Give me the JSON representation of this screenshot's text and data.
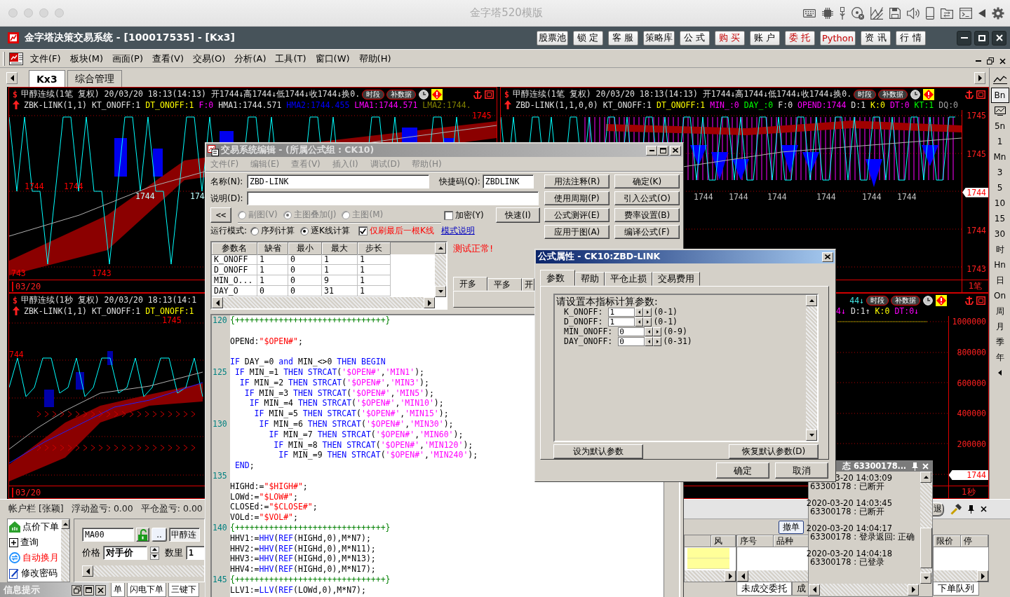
{
  "mac_window": {
    "title": "金字塔520模版"
  },
  "app_window": {
    "title": "金字塔决策交易系统 - [100017535] - [Kx3]",
    "toolbar": [
      {
        "label": "股票池",
        "kind": "plain"
      },
      {
        "label": "锁 定",
        "kind": "plain"
      },
      {
        "label": "客 服",
        "kind": "plain"
      },
      {
        "label": "策略库",
        "kind": "plain"
      },
      {
        "label": "公 式",
        "kind": "plain"
      },
      {
        "label": "购 买",
        "kind": "accent"
      },
      {
        "label": "账 户",
        "kind": "plain"
      },
      {
        "label": "委 托",
        "kind": "accent"
      },
      {
        "label": "Python",
        "kind": "accent"
      },
      {
        "label": "资 讯",
        "kind": "plain"
      },
      {
        "label": "行 情",
        "kind": "plain"
      }
    ]
  },
  "menu": [
    "文件(F)",
    "板块(M)",
    "画面(P)",
    "查看(V)",
    "交易(O)",
    "分析(A)",
    "工具(T)",
    "窗口(W)",
    "帮助(H)"
  ],
  "tabs": [
    {
      "label": "Kx3",
      "selected": true
    },
    {
      "label": "综合管理",
      "selected": false
    }
  ],
  "charts": [
    {
      "symbol": "$",
      "title": "甲醇连续(1笔 复权) 20/03/20 18:13(14:13) 开1744↓高1744↓低1744↓收1744↓换0.",
      "buttons": [
        "时段",
        "补数据"
      ],
      "tools": true,
      "arrow": true,
      "indicator": [
        {
          "text": "ZBK-LINK(1,1)",
          "color": "#e0e0e0"
        },
        {
          "text": "KT_ONOFF:1",
          "color": "#e0e0e0"
        },
        {
          "text": "DT_ONOFF:1",
          "color": "#ffff00"
        },
        {
          "text": "F:0",
          "color": "#ff00ff"
        },
        {
          "text": "HMA1:1744.571",
          "color": "#e0e0e0"
        },
        {
          "text": "HMA2:1744.455",
          "color": "#0000ff"
        },
        {
          "text": "LMA1:1744.571",
          "color": "#ff00ff"
        },
        {
          "text": "LMA2:1744.",
          "color": "#808000"
        }
      ],
      "plot_labels": [
        {
          "text": "1745",
          "color": "#ff0000"
        },
        {
          "text": "1744",
          "color": "#ff0000"
        },
        {
          "text": "1744",
          "color": "#ff0000"
        },
        {
          "text": "1744",
          "color": "#c0ffff"
        },
        {
          "text": "174",
          "color": "#c0ffff"
        },
        {
          "text": "743",
          "color": "#ff0000"
        },
        {
          "text": "1743",
          "color": "#ff0000"
        }
      ],
      "date": "03/20"
    },
    {
      "symbol": "$",
      "title": "甲醇连续(1笔 复权) 20/03/20 18:13(14:13) 开1744↓高1744↓低1744↓收1744↓换0.",
      "buttons": [
        "时段",
        "补数据"
      ],
      "tools": true,
      "arrow": true,
      "indicator": [
        {
          "text": "ZBD-LINK(1,1,0,0)",
          "color": "#e0e0e0"
        },
        {
          "text": "KT_ONOFF:1",
          "color": "#e0e0e0"
        },
        {
          "text": "DT_ONOFF:1",
          "color": "#ffff00"
        },
        {
          "text": "MIN_:0",
          "color": "#ff00ff"
        },
        {
          "text": "DAY_:0",
          "color": "#00ff00"
        },
        {
          "text": "F:0",
          "color": "#e0e0e0"
        },
        {
          "text": "OPEND:1744",
          "color": "#ff00ff"
        },
        {
          "text": "D:1",
          "color": "#e0e0e0"
        },
        {
          "text": "K:0",
          "color": "#ffff00"
        },
        {
          "text": "DT:0",
          "color": "#ff00ff"
        },
        {
          "text": "KT:1",
          "color": "#00ff00"
        },
        {
          "text": "DQ:0",
          "color": "#a0a0a0"
        }
      ],
      "axis": [
        {
          "text": "1745",
          "kind": "tick"
        },
        {
          "text": "1745",
          "kind": "tick"
        },
        {
          "text": "1744",
          "kind": "tag"
        },
        {
          "text": "1744",
          "kind": "tick"
        },
        {
          "text": "1743",
          "kind": "tick"
        }
      ],
      "plot_labels": [
        {
          "text": "1744",
          "color": "#c0c0c0"
        },
        {
          "text": "1744",
          "color": "#c0c0c0"
        },
        {
          "text": "1744",
          "color": "#c0c0c0"
        },
        {
          "text": "1744",
          "color": "#c0c0c0"
        },
        {
          "text": "1744",
          "color": "#c0c0c0"
        },
        {
          "text": "1744",
          "color": "#c0c0c0"
        }
      ],
      "corner": "1笔"
    },
    {
      "symbol": "$",
      "title": "甲醇连续(1秒 复权) 20/03/20 18:13(14:1",
      "arrow": true,
      "indicator": [
        {
          "text": "ZBK-LINK(1,1)",
          "color": "#e0e0e0"
        },
        {
          "text": "KT_ONOFF:1",
          "color": "#e0e0e0"
        },
        {
          "text": "DT_ONOFF:1",
          "color": "#ffff00"
        }
      ],
      "plot_labels": [
        {
          "text": "1745",
          "color": "#ff0000"
        },
        {
          "text": "744",
          "color": "#ff0000"
        }
      ],
      "date": "03/20"
    },
    {
      "title": "44↓",
      "buttons": [
        "时段",
        "补数据"
      ],
      "tools": true,
      "indicator": [
        {
          "text": "4↓",
          "color": "#ff00ff"
        },
        {
          "text": "D:1↑",
          "color": "#e0e0e0"
        },
        {
          "text": "K:0",
          "color": "#ffff00"
        },
        {
          "text": "DT:0↓",
          "color": "#ff00ff"
        }
      ],
      "axis": [
        {
          "text": "1000000",
          "kind": "tick"
        },
        {
          "text": "800000",
          "kind": "tick"
        },
        {
          "text": "600000",
          "kind": "tick"
        },
        {
          "text": "400000",
          "kind": "tick"
        },
        {
          "text": "200000",
          "kind": "tick"
        },
        {
          "text": "1744",
          "kind": "tag"
        }
      ],
      "corner": "1秒"
    }
  ],
  "period_bar": [
    {
      "kind": "chart",
      "selected": false
    },
    {
      "kind": "text",
      "label": "Bn",
      "selected": true
    },
    {
      "kind": "screen",
      "selected": false
    },
    {
      "kind": "text",
      "label": "5n",
      "selected": false
    },
    {
      "kind": "text",
      "label": "1",
      "selected": false
    },
    {
      "kind": "text",
      "label": "Mn",
      "selected": false
    },
    {
      "kind": "text",
      "label": "3",
      "selected": false
    },
    {
      "kind": "text",
      "label": "5",
      "selected": false
    },
    {
      "kind": "text",
      "label": "10",
      "selected": false
    },
    {
      "kind": "text",
      "label": "15",
      "selected": false
    },
    {
      "kind": "text",
      "label": "30",
      "selected": false
    },
    {
      "kind": "text",
      "label": "时",
      "selected": false
    },
    {
      "kind": "text",
      "label": "Hn",
      "selected": false
    },
    {
      "kind": "text",
      "label": "日",
      "selected": false
    },
    {
      "kind": "text",
      "label": "On",
      "selected": false
    },
    {
      "kind": "text",
      "label": "周",
      "selected": false
    },
    {
      "kind": "text",
      "label": "月",
      "selected": false
    },
    {
      "kind": "text",
      "label": "季",
      "selected": false
    },
    {
      "kind": "text",
      "label": "年",
      "selected": false
    },
    {
      "kind": "caret"
    }
  ],
  "editor": {
    "title": "交易系统编辑 - (所属公式组 : CK10)",
    "menu": [
      {
        "label": "文件(F)",
        "disabled": true
      },
      {
        "label": "编辑(E)",
        "disabled": true
      },
      {
        "label": "查看(V)",
        "disabled": true
      },
      {
        "label": "插入(I)",
        "disabled": true
      },
      {
        "label": "调试(D)",
        "disabled": true
      },
      {
        "label": "帮助(H)",
        "disabled": true
      }
    ],
    "name_field": {
      "label": "名称(N):",
      "value": "ZBD-LINK"
    },
    "shortcut_field": {
      "label": "快捷码(Q):",
      "value": "ZBDLINK"
    },
    "description_field": {
      "label": "说明(D):"
    },
    "collapse_button": "<<",
    "chart_types": [
      {
        "label": "副图(V)",
        "selected": false,
        "disabled": true
      },
      {
        "label": "主图叠加(J)",
        "selected": true,
        "disabled": true
      },
      {
        "label": "主图(M)",
        "selected": false,
        "disabled": true
      }
    ],
    "encrypt": {
      "label": "加密(Y)",
      "checked": false
    },
    "fast_button": "快速(I)",
    "run_mode": {
      "label": "运行模式:",
      "options": [
        {
          "label": "序列计算",
          "selected": false
        },
        {
          "label": "逐K线计算",
          "selected": true
        }
      ],
      "refresh_last": {
        "label": "仅刷最后一根K线",
        "checked": true
      },
      "link": "模式说明"
    },
    "buttons": [
      "用法注释(R)",
      "确定(K)",
      "使用周期(P)",
      "引入公式(O)",
      "公式测评(E)",
      "费率设置(B)",
      "应用于图(A)",
      "编译公式(F)"
    ],
    "params_table": {
      "columns": [
        "参数名",
        "缺省",
        "最小",
        "最大",
        "步长"
      ],
      "rows": [
        [
          "K_ONOFF",
          "1",
          "0",
          "1",
          "1"
        ],
        [
          "D_ONOFF",
          "1",
          "0",
          "1",
          "1"
        ],
        [
          "MIN_O...",
          "1",
          "0",
          "9",
          "1"
        ],
        [
          "DAY_O",
          "0",
          "0",
          "31",
          "1"
        ]
      ]
    },
    "status": "测试正常!",
    "signal_tabs": [
      {
        "label": "开多",
        "selected": true
      },
      {
        "label": "平多",
        "selected": false
      },
      {
        "label": "开",
        "selected": false
      }
    ],
    "code": [
      {
        "number": "120",
        "tokens": [
          {
            "kind": "comment",
            "text": "{+++++++++++++++++++++++++++++++}"
          }
        ]
      },
      {
        "blank_before": true,
        "tokens": [
          {
            "kind": "code",
            "text": "OPENd:"
          },
          {
            "kind": "literal",
            "text": "\"$OPEN#\""
          },
          {
            "kind": "code",
            "text": ";"
          }
        ]
      },
      {
        "blank_before": true,
        "tokens": [
          {
            "kind": "keyword",
            "text": "IF"
          },
          {
            "kind": "code",
            "text": " DAY_=0 "
          },
          {
            "kind": "keyword",
            "text": "and"
          },
          {
            "kind": "code",
            "text": " MIN_<>0 "
          },
          {
            "kind": "keyword",
            "text": "THEN BEGIN"
          }
        ]
      },
      {
        "number": "125",
        "tokens": [
          {
            "kind": "keyword",
            "text": " IF"
          },
          {
            "kind": "code",
            "text": " MIN_=1 "
          },
          {
            "kind": "keyword",
            "text": "THEN STRCAT"
          },
          {
            "kind": "code",
            "text": "("
          },
          {
            "kind": "string",
            "text": "'$OPEN#'"
          },
          {
            "kind": "code",
            "text": ","
          },
          {
            "kind": "string",
            "text": "'MIN1'"
          },
          {
            "kind": "code",
            "text": ");"
          }
        ]
      },
      {
        "tokens": [
          {
            "kind": "keyword",
            "text": "  IF"
          },
          {
            "kind": "code",
            "text": " MIN_=2 "
          },
          {
            "kind": "keyword",
            "text": "THEN STRCAT"
          },
          {
            "kind": "code",
            "text": "("
          },
          {
            "kind": "string",
            "text": "'$OPEN#'"
          },
          {
            "kind": "code",
            "text": ","
          },
          {
            "kind": "string",
            "text": "'MIN3'"
          },
          {
            "kind": "code",
            "text": ");"
          }
        ]
      },
      {
        "tokens": [
          {
            "kind": "keyword",
            "text": "   IF"
          },
          {
            "kind": "code",
            "text": " MIN_=3 "
          },
          {
            "kind": "keyword",
            "text": "THEN STRCAT"
          },
          {
            "kind": "code",
            "text": "("
          },
          {
            "kind": "string",
            "text": "'$OPEN#'"
          },
          {
            "kind": "code",
            "text": ","
          },
          {
            "kind": "string",
            "text": "'MIN5'"
          },
          {
            "kind": "code",
            "text": ");"
          }
        ]
      },
      {
        "tokens": [
          {
            "kind": "keyword",
            "text": "    IF"
          },
          {
            "kind": "code",
            "text": " MIN_=4 "
          },
          {
            "kind": "keyword",
            "text": "THEN STRCAT"
          },
          {
            "kind": "code",
            "text": "("
          },
          {
            "kind": "string",
            "text": "'$OPEN#'"
          },
          {
            "kind": "code",
            "text": ","
          },
          {
            "kind": "string",
            "text": "'MIN10'"
          },
          {
            "kind": "code",
            "text": ");"
          }
        ]
      },
      {
        "tokens": [
          {
            "kind": "keyword",
            "text": "     IF"
          },
          {
            "kind": "code",
            "text": " MIN_=5 "
          },
          {
            "kind": "keyword",
            "text": "THEN STRCAT"
          },
          {
            "kind": "code",
            "text": "("
          },
          {
            "kind": "string",
            "text": "'$OPEN#'"
          },
          {
            "kind": "code",
            "text": ","
          },
          {
            "kind": "string",
            "text": "'MIN15'"
          },
          {
            "kind": "code",
            "text": ");"
          }
        ]
      },
      {
        "number": "130",
        "tokens": [
          {
            "kind": "keyword",
            "text": "      IF"
          },
          {
            "kind": "code",
            "text": " MIN_=6 "
          },
          {
            "kind": "keyword",
            "text": "THEN STRCAT"
          },
          {
            "kind": "code",
            "text": "("
          },
          {
            "kind": "string",
            "text": "'$OPEN#'"
          },
          {
            "kind": "code",
            "text": ","
          },
          {
            "kind": "string",
            "text": "'MIN30'"
          },
          {
            "kind": "code",
            "text": ");"
          }
        ]
      },
      {
        "tokens": [
          {
            "kind": "keyword",
            "text": "        IF"
          },
          {
            "kind": "code",
            "text": " MIN_=7 "
          },
          {
            "kind": "keyword",
            "text": "THEN STRCAT"
          },
          {
            "kind": "code",
            "text": "("
          },
          {
            "kind": "string",
            "text": "'$OPEN#'"
          },
          {
            "kind": "code",
            "text": ","
          },
          {
            "kind": "string",
            "text": "'MIN60'"
          },
          {
            "kind": "code",
            "text": ");"
          }
        ]
      },
      {
        "tokens": [
          {
            "kind": "keyword",
            "text": "         IF"
          },
          {
            "kind": "code",
            "text": " MIN_=8 "
          },
          {
            "kind": "keyword",
            "text": "THEN STRCAT"
          },
          {
            "kind": "code",
            "text": "("
          },
          {
            "kind": "string",
            "text": "'$OPEN#'"
          },
          {
            "kind": "code",
            "text": ","
          },
          {
            "kind": "string",
            "text": "'MIN120'"
          },
          {
            "kind": "code",
            "text": ");"
          }
        ]
      },
      {
        "tokens": [
          {
            "kind": "keyword",
            "text": "          IF"
          },
          {
            "kind": "code",
            "text": " MIN_=9 "
          },
          {
            "kind": "keyword",
            "text": "THEN STRCAT"
          },
          {
            "kind": "code",
            "text": "("
          },
          {
            "kind": "string",
            "text": "'$OPEN#'"
          },
          {
            "kind": "code",
            "text": ","
          },
          {
            "kind": "string",
            "text": "'MIN240'"
          },
          {
            "kind": "code",
            "text": ");"
          }
        ]
      },
      {
        "tokens": [
          {
            "kind": "keyword",
            "text": " END"
          },
          {
            "kind": "code",
            "text": ";"
          }
        ]
      },
      {
        "number": "135"
      },
      {
        "tokens": [
          {
            "kind": "code",
            "text": "HIGHd:="
          },
          {
            "kind": "literal",
            "text": "\"$HIGH#\""
          },
          {
            "kind": "code",
            "text": ";"
          }
        ]
      },
      {
        "tokens": [
          {
            "kind": "code",
            "text": "LOWd:="
          },
          {
            "kind": "literal",
            "text": "\"$LOW#\""
          },
          {
            "kind": "code",
            "text": ";"
          }
        ]
      },
      {
        "tokens": [
          {
            "kind": "code",
            "text": "CLOSEd:="
          },
          {
            "kind": "literal",
            "text": "\"$CLOSE#\""
          },
          {
            "kind": "code",
            "text": ";"
          }
        ]
      },
      {
        "tokens": [
          {
            "kind": "code",
            "text": "VOLd:="
          },
          {
            "kind": "literal",
            "text": "\"$VOL#\""
          },
          {
            "kind": "code",
            "text": ";"
          }
        ]
      },
      {
        "number": "140",
        "tokens": [
          {
            "kind": "comment",
            "text": "{+++++++++++++++++++++++++++++++}"
          }
        ]
      },
      {
        "tokens": [
          {
            "kind": "code",
            "text": "HHV1:="
          },
          {
            "kind": "keyword",
            "text": "HHV"
          },
          {
            "kind": "code",
            "text": "("
          },
          {
            "kind": "keyword",
            "text": "REF"
          },
          {
            "kind": "code",
            "text": "(HIGHd,0),M*N7);"
          }
        ]
      },
      {
        "tokens": [
          {
            "kind": "code",
            "text": "HHV2:="
          },
          {
            "kind": "keyword",
            "text": "HHV"
          },
          {
            "kind": "code",
            "text": "("
          },
          {
            "kind": "keyword",
            "text": "REF"
          },
          {
            "kind": "code",
            "text": "(HIGHd,0),M*N11);"
          }
        ]
      },
      {
        "tokens": [
          {
            "kind": "code",
            "text": "HHV3:="
          },
          {
            "kind": "keyword",
            "text": "HHV"
          },
          {
            "kind": "code",
            "text": "("
          },
          {
            "kind": "keyword",
            "text": "REF"
          },
          {
            "kind": "code",
            "text": "(HIGHd,0),M*N13);"
          }
        ]
      },
      {
        "tokens": [
          {
            "kind": "code",
            "text": "HHV4:="
          },
          {
            "kind": "keyword",
            "text": "HHV"
          },
          {
            "kind": "code",
            "text": "("
          },
          {
            "kind": "keyword",
            "text": "REF"
          },
          {
            "kind": "code",
            "text": "(HIGHd,0),M*N17);"
          }
        ]
      },
      {
        "number": "145",
        "tokens": [
          {
            "kind": "comment",
            "text": "{+++++++++++++++++++++++++++++++}"
          }
        ]
      },
      {
        "tokens": [
          {
            "kind": "code",
            "text": "LLV1:="
          },
          {
            "kind": "keyword",
            "text": "LLV"
          },
          {
            "kind": "code",
            "text": "("
          },
          {
            "kind": "keyword",
            "text": "REF"
          },
          {
            "kind": "code",
            "text": "(LOWd,0),M*N7);"
          }
        ]
      }
    ]
  },
  "properties_dialog": {
    "title": "公式属性 - CK10:ZBD-LINK",
    "tabs": [
      {
        "label": "参数",
        "selected": true
      },
      {
        "label": "帮助",
        "selected": false
      },
      {
        "label": "平仓止损",
        "selected": false
      },
      {
        "label": "交易费用",
        "selected": false
      }
    ],
    "prompt": "请设置本指标计算参数:",
    "params": [
      {
        "label": "K_ONOFF:",
        "value": "1",
        "range": "(0-1)"
      },
      {
        "label": "D_ONOFF:",
        "value": "1",
        "range": "(0-1)"
      },
      {
        "label": "MIN_ONOFF:",
        "value": "0",
        "range": "(0-9)"
      },
      {
        "label": "DAY_ONOFF:",
        "value": "0",
        "range": "(0-31)"
      }
    ],
    "panel_buttons": [
      "设为默认参数",
      "恢复默认参数(D)"
    ],
    "buttons": [
      "确定",
      "取消"
    ]
  },
  "log_panel": {
    "title": "态 63300178...",
    "entries": [
      {
        "time": "3-20 14:03:09",
        "message": "63300178 : 已断开"
      },
      {
        "time": "2020-03-20 14:03:45",
        "message": "63300178 : 已断开"
      },
      {
        "time": "2020-03-20 14:04:17",
        "message": "63300178 : 登录返回: 正确"
      },
      {
        "time": "2020-03-20 14:04:18",
        "message": "63300178 : 已登录"
      }
    ]
  },
  "account_panel": {
    "header": [
      "帐户栏 [张颖]",
      "浮动盈亏: 0.00",
      "平仓盈亏: 0.00"
    ],
    "actions": [
      {
        "kind": "order",
        "label": "点价下单"
      },
      {
        "kind": "query",
        "label": "查询"
      },
      {
        "kind": "rollover",
        "label": "自动换月"
      },
      {
        "kind": "password",
        "label": "修改密码"
      }
    ],
    "order_form": {
      "contract": "MA00",
      "more": "..",
      "instrument": "甲醇连",
      "price_label": "价格",
      "price": "对手价",
      "quantity_label": "数里",
      "quantity": "1"
    },
    "info_bar": "信息提示",
    "form_tabs": [
      {
        "label": "单",
        "selected": false
      },
      {
        "label": "闪电下单",
        "selected": false
      },
      {
        "label": "三键下",
        "selected": false
      }
    ],
    "exit_button": "退",
    "cancel_button": "撤单",
    "risk_columns": [
      "风"
    ],
    "order_columns": [
      "序号",
      "品种"
    ],
    "order_tabs": [
      {
        "label": "未成交委托",
        "selected": true
      },
      {
        "label": "成",
        "selected": false
      }
    ],
    "queue_columns": [
      "限价",
      "停"
    ],
    "queue_tabs": [
      {
        "label": "下单队列",
        "selected": true
      }
    ]
  }
}
